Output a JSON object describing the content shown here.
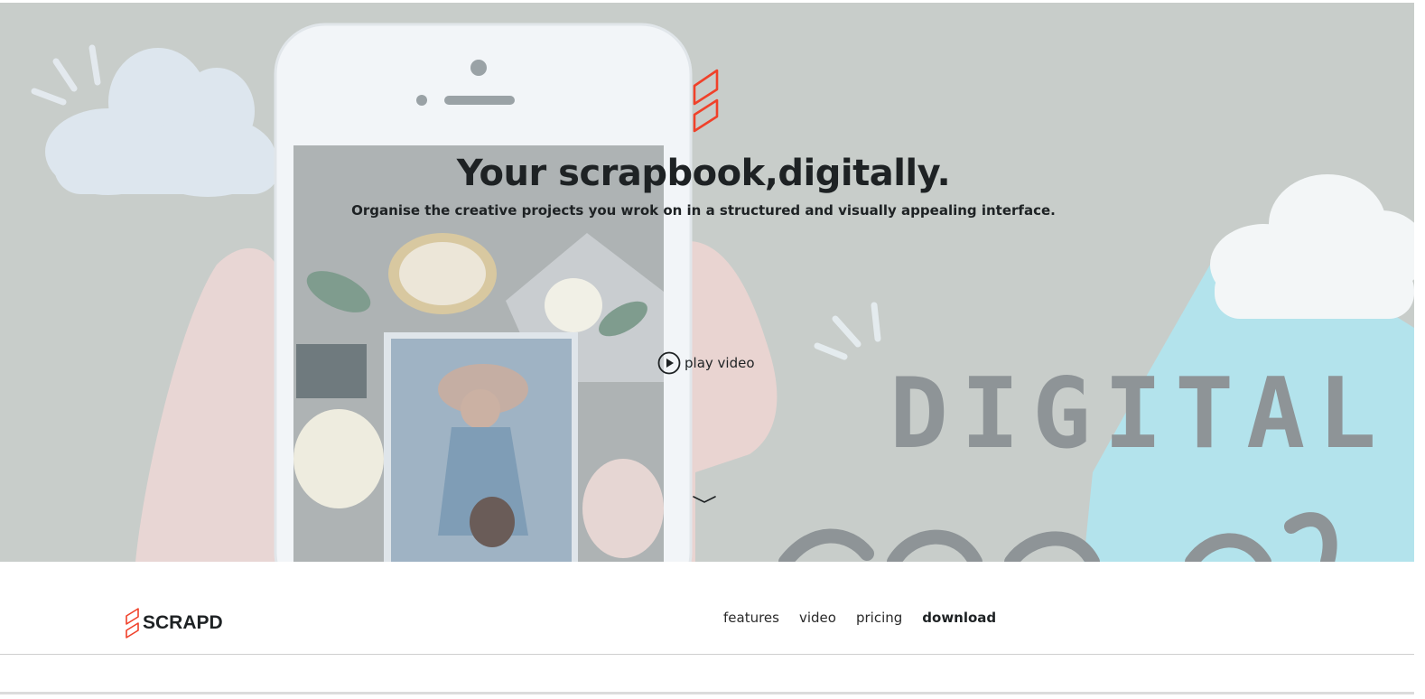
{
  "hero": {
    "title": "Your scrapbook,digitally.",
    "subtitle": "Organise the creative projects you wrok on in a structured and visually appealing interface.",
    "play_label": "play video",
    "background_text": "DIGITAL",
    "accent_color": "#f0412a",
    "icons": [
      "logo-icon",
      "play-circle-icon",
      "chevron-down-icon"
    ]
  },
  "navbar": {
    "brand": "SCRAPD",
    "links": [
      {
        "label": "features",
        "active": false
      },
      {
        "label": "video",
        "active": false
      },
      {
        "label": "pricing",
        "active": false
      },
      {
        "label": "download",
        "active": true
      }
    ]
  }
}
